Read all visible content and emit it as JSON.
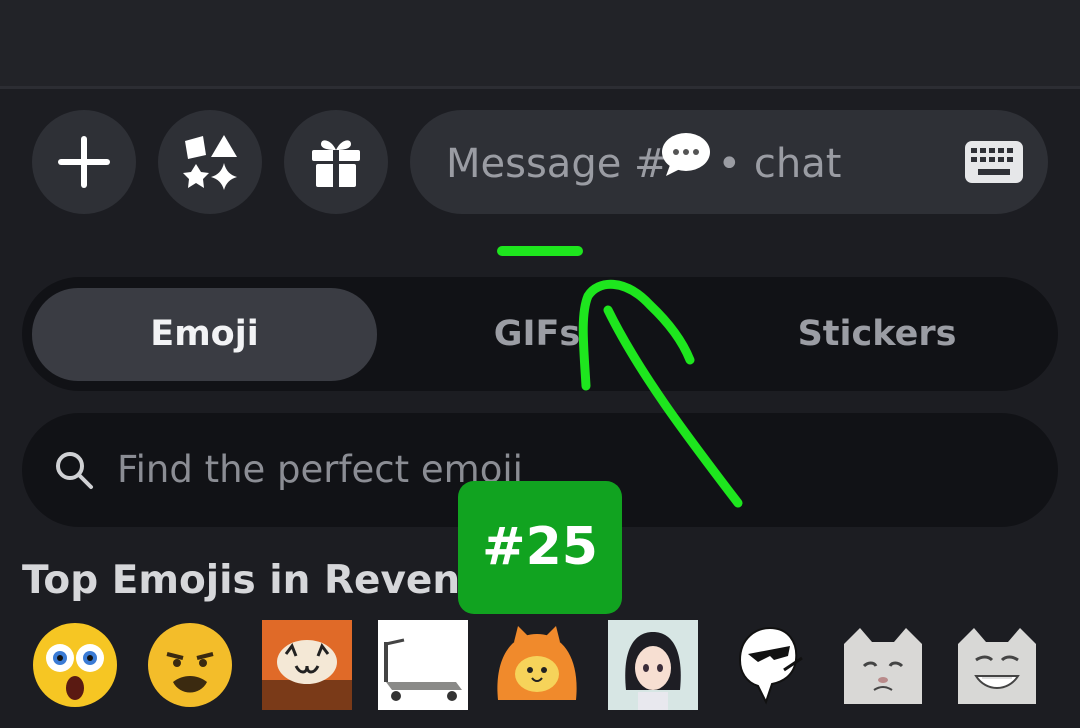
{
  "composer": {
    "add_icon": "plus-icon",
    "apps_icon": "apps-shapes-icon",
    "gift_icon": "gift-icon",
    "placeholder_prefix": "Message #",
    "placeholder_suffix": "• chat",
    "channel_icon": "speech-bubble-icon",
    "keyboard_icon": "keyboard-icon"
  },
  "picker_tabs": [
    {
      "label": "Emoji",
      "active": true
    },
    {
      "label": "GIFs",
      "active": false
    },
    {
      "label": "Stickers",
      "active": false
    }
  ],
  "search": {
    "placeholder": "Find the perfect emoji",
    "icon": "search-icon"
  },
  "section": {
    "title": "Top Emojis in Revenge"
  },
  "emojis": [
    "flushed-screaming-emoji",
    "sad-mustache-face-emoji",
    "explosion-cat-emoji",
    "flatbed-cart-emoji",
    "orange-blob-cat-emoji",
    "anime-girl-emoji",
    "sunglasses-ghost-emoji",
    "crying-cat-emoji",
    "grinning-cat-emoji"
  ],
  "annotation": {
    "badge_text": "#25",
    "color": "#1ee61e",
    "badge_color": "#11a320"
  }
}
